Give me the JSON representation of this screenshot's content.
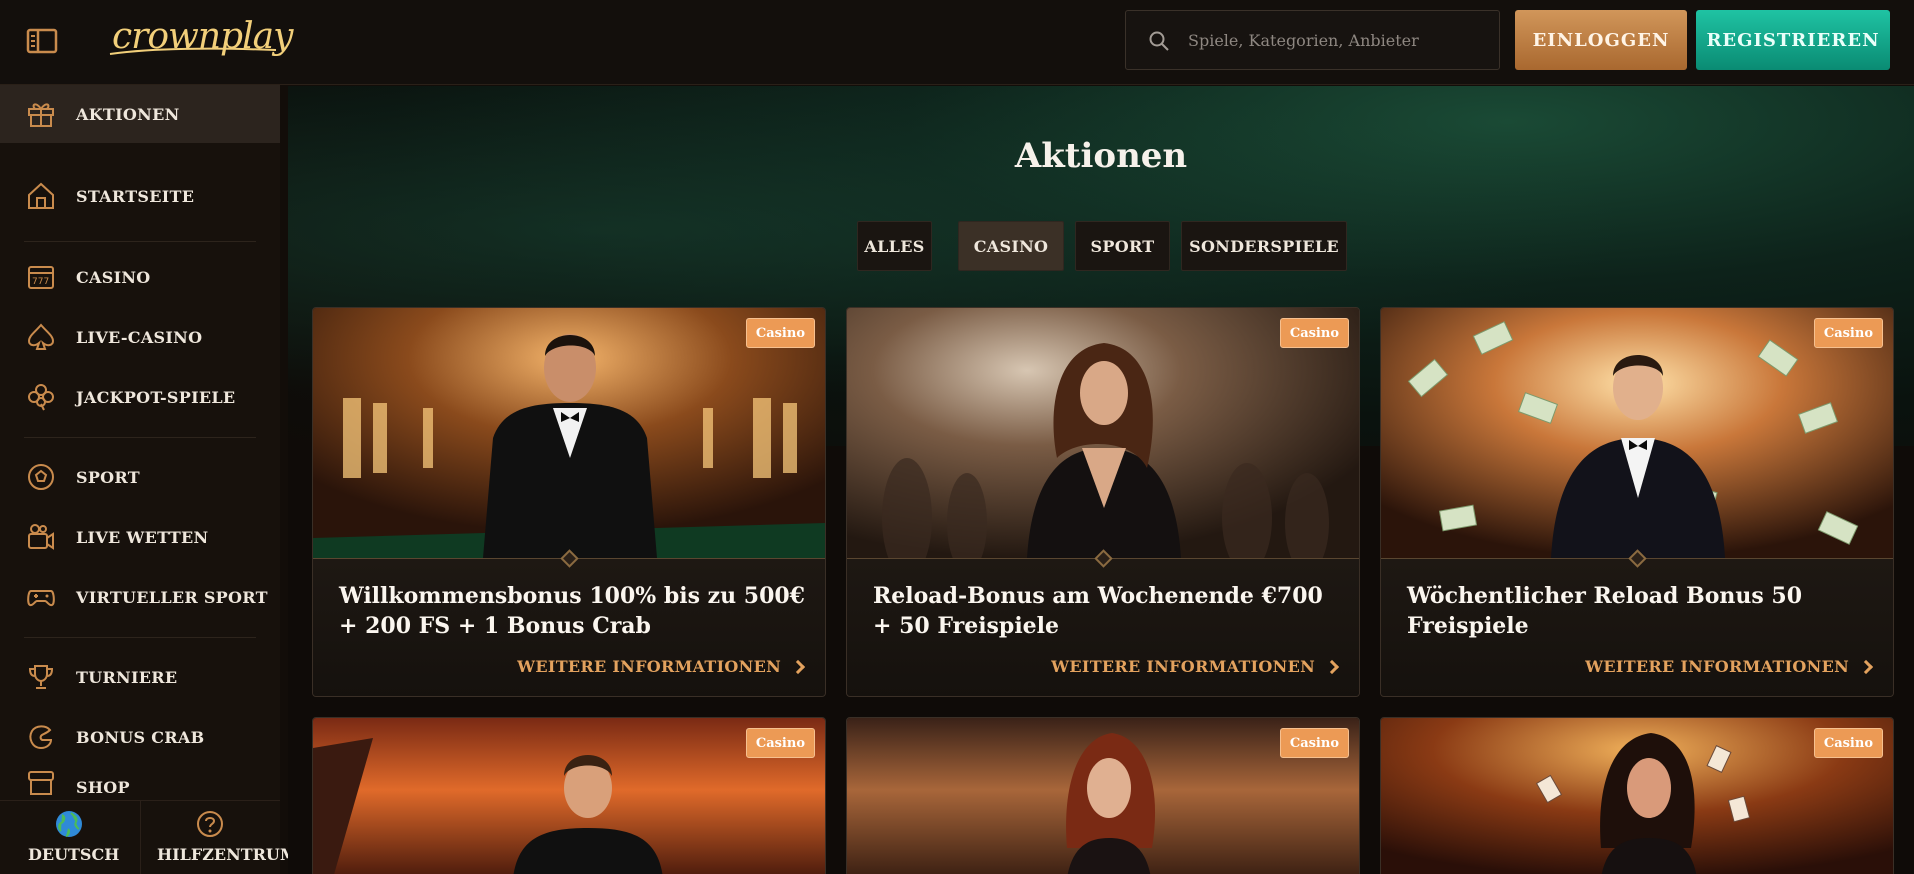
{
  "header": {
    "logo": "crownplay",
    "search_placeholder": "Spiele, Kategorien, Anbieter",
    "login_label": "EINLOGGEN",
    "register_label": "REGISTRIEREN"
  },
  "sidebar": {
    "items": [
      {
        "label": "AKTIONEN",
        "icon": "gift-icon",
        "active": true
      },
      {
        "label": "STARTSEITE",
        "icon": "home-icon"
      },
      {
        "label": "CASINO",
        "icon": "slot-machine-icon"
      },
      {
        "label": "LIVE-CASINO",
        "icon": "spade-icon"
      },
      {
        "label": "JACKPOT-SPIELE",
        "icon": "clover-icon"
      },
      {
        "label": "SPORT",
        "icon": "soccer-ball-icon"
      },
      {
        "label": "LIVE WETTEN",
        "icon": "camera-icon"
      },
      {
        "label": "VIRTUELLER SPORT",
        "icon": "gamepad-icon"
      },
      {
        "label": "TURNIERE",
        "icon": "trophy-icon"
      },
      {
        "label": "BONUS CRAB",
        "icon": "crab-claw-icon"
      },
      {
        "label": "SHOP",
        "icon": "shop-icon"
      }
    ],
    "footer": {
      "language_label": "DEUTSCH",
      "help_label": "HILFZENTRUM"
    }
  },
  "main": {
    "title": "Aktionen",
    "tabs": [
      {
        "label": "ALLES",
        "active": false
      },
      {
        "label": "CASINO",
        "active": true
      },
      {
        "label": "SPORT",
        "active": false
      },
      {
        "label": "SONDERSPIELE",
        "active": false
      }
    ],
    "cards": [
      {
        "badge": "Casino",
        "title": "Willkommensbonus 100% bis zu 500€ + 200 FS + 1 Bonus Crab",
        "link": "WEITERE INFORMATIONEN"
      },
      {
        "badge": "Casino",
        "title": "Reload-Bonus am Wochenende €700 + 50 Freispiele",
        "link": "WEITERE INFORMATIONEN"
      },
      {
        "badge": "Casino",
        "title": "Wöchentlicher Reload Bonus 50 Freispiele",
        "link": "WEITERE INFORMATIONEN"
      },
      {
        "badge": "Casino"
      },
      {
        "badge": "Casino"
      },
      {
        "badge": "Casino"
      }
    ]
  },
  "colors": {
    "accent_gold": "#e3a25e",
    "login_btn": "#c1834a",
    "register_btn": "#15a98b",
    "badge": "#ec9a55"
  }
}
